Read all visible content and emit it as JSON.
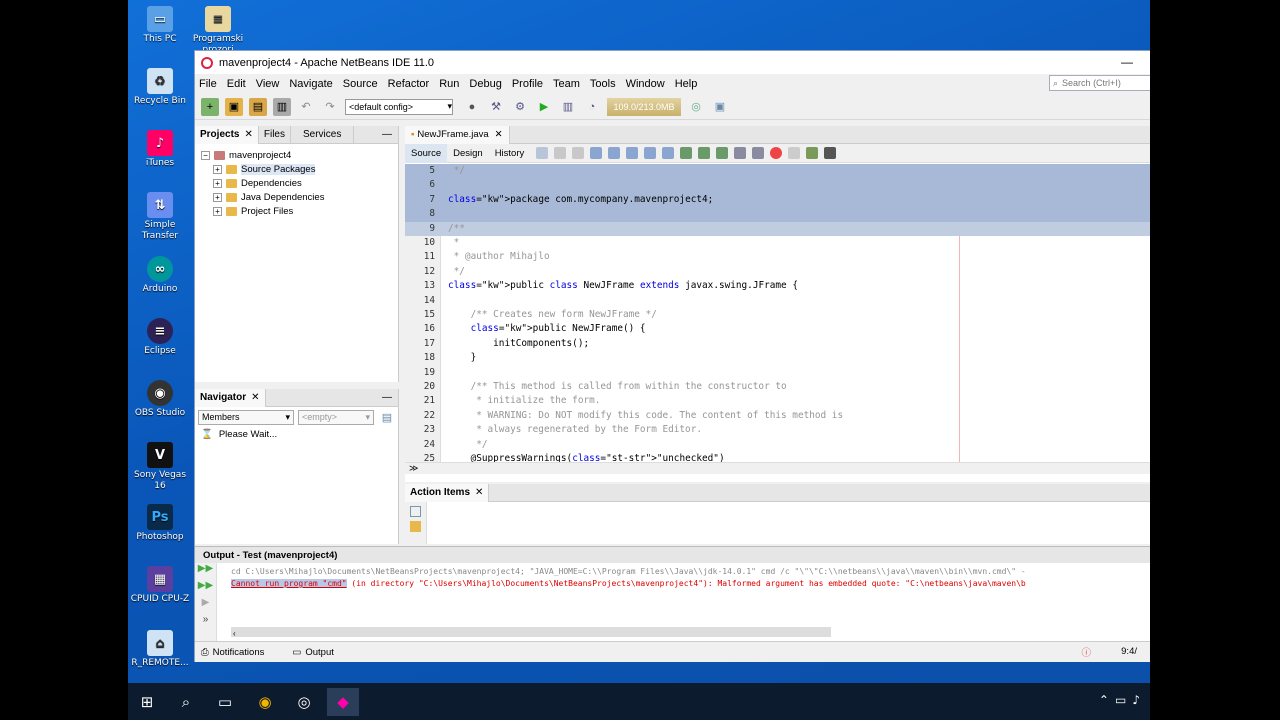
{
  "desktop": {
    "icons": [
      "This PC",
      "Programski prozori",
      "Recycle Bin",
      "iTunes",
      "Simple Transfer",
      "Arduino",
      "Eclipse",
      "OBS Studio",
      "Sony Vegas 16",
      "Photoshop",
      "CPUID CPU-Z",
      "R_REMOTE..."
    ]
  },
  "window": {
    "title": "mavenproject4 - Apache NetBeans IDE 11.0"
  },
  "menu": [
    "File",
    "Edit",
    "View",
    "Navigate",
    "Source",
    "Refactor",
    "Run",
    "Debug",
    "Profile",
    "Team",
    "Tools",
    "Window",
    "Help"
  ],
  "search": {
    "placeholder": "Search (Ctrl+I)"
  },
  "toolbar": {
    "config": "<default config>",
    "memory": "109.0/213.0MB"
  },
  "projects": {
    "tabs": [
      "Projects",
      "Files",
      "Services"
    ],
    "root": "mavenproject4",
    "children": [
      "Source Packages",
      "Dependencies",
      "Java Dependencies",
      "Project Files"
    ]
  },
  "navigator": {
    "title": "Navigator",
    "members": "Members",
    "empty": "<empty>",
    "status": "Please Wait..."
  },
  "editor": {
    "tab": "NewJFrame.java",
    "subtabs": [
      "Source",
      "Design",
      "History"
    ],
    "lines": [
      {
        "n": "5",
        "text": " */"
      },
      {
        "n": "6",
        "text": ""
      },
      {
        "n": "7",
        "text": "package com.mycompany.mavenproject4;"
      },
      {
        "n": "8",
        "text": ""
      },
      {
        "n": "9",
        "text": "/**"
      },
      {
        "n": "10",
        "text": " *"
      },
      {
        "n": "11",
        "text": " * @author Mihajlo"
      },
      {
        "n": "12",
        "text": " */"
      },
      {
        "n": "13",
        "text": "public class NewJFrame extends javax.swing.JFrame {"
      },
      {
        "n": "14",
        "text": ""
      },
      {
        "n": "15",
        "text": "    /** Creates new form NewJFrame */"
      },
      {
        "n": "16",
        "text": "    public NewJFrame() {"
      },
      {
        "n": "17",
        "text": "        initComponents();"
      },
      {
        "n": "18",
        "text": "    }"
      },
      {
        "n": "19",
        "text": ""
      },
      {
        "n": "20",
        "text": "    /** This method is called from within the constructor to"
      },
      {
        "n": "21",
        "text": "     * initialize the form."
      },
      {
        "n": "22",
        "text": "     * WARNING: Do NOT modify this code. The content of this method is"
      },
      {
        "n": "23",
        "text": "     * always regenerated by the Form Editor."
      },
      {
        "n": "24",
        "text": "     */"
      },
      {
        "n": "25",
        "text": "    @SuppressWarnings(\"unchecked\")"
      }
    ]
  },
  "action_items": {
    "title": "Action Items"
  },
  "output": {
    "title": "Output - Test (mavenproject4)",
    "line1": "cd C:\\Users\\Mihajlo\\Documents\\NetBeansProjects\\mavenproject4; \"JAVA_HOME=C:\\\\Program Files\\\\Java\\\\jdk-14.0.1\" cmd /c \"\\\"\\\"C:\\\\netbeans\\\\java\\\\maven\\\\bin\\\\mvn.cmd\\\" -",
    "error_selected": "Cannot run program \"cmd\"",
    "error_rest": " (in directory \"C:\\Users\\Mihajlo\\Documents\\NetBeansProjects\\mavenproject4\"): Malformed argument has embedded quote: \"C:\\netbeans\\java\\maven\\b"
  },
  "status": {
    "notifications": "Notifications",
    "output": "Output",
    "position": "9:4/"
  }
}
